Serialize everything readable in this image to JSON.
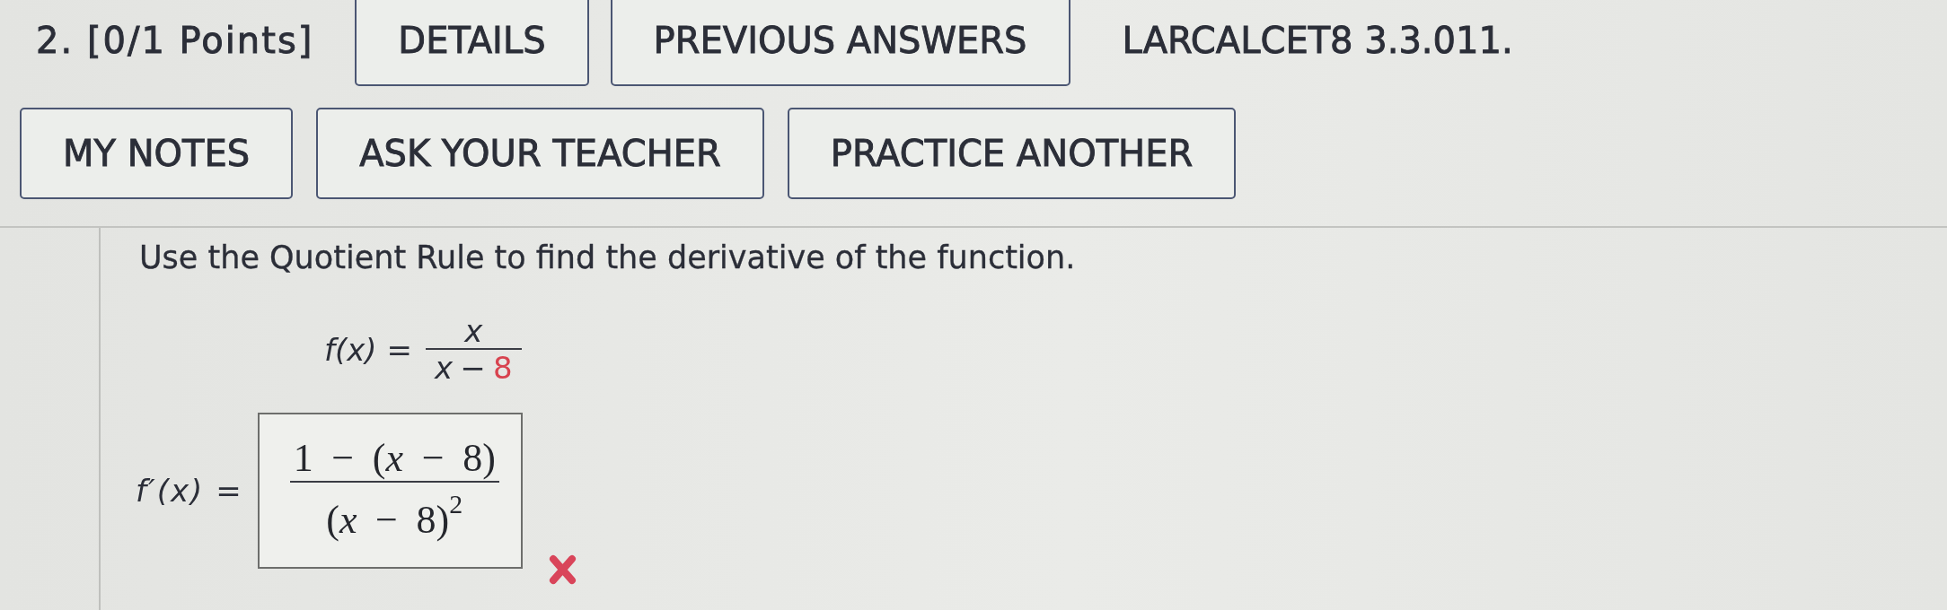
{
  "header": {
    "heading": "2. [0/1 Points]",
    "buttons": [
      "DETAILS",
      "PREVIOUS ANSWERS"
    ],
    "reference": "LARCALCET8 3.3.011."
  },
  "actions": [
    "MY NOTES",
    "ASK YOUR TEACHER",
    "PRACTICE ANOTHER"
  ],
  "question": {
    "prompt": "Use the Quotient Rule to find the derivative of the function.",
    "function": {
      "label": "f(x) =",
      "numerator": "x",
      "denominator": [
        {
          "text": "x",
          "highlighted": false
        },
        {
          "text": "−",
          "highlighted": false
        },
        {
          "text": "8",
          "highlighted": true
        }
      ]
    },
    "answer": {
      "label": "f′(x) =",
      "numerator": "1 − (*x* − 8)",
      "denominator": "(*x* − 8)$^{2}$",
      "correct": false
    }
  }
}
